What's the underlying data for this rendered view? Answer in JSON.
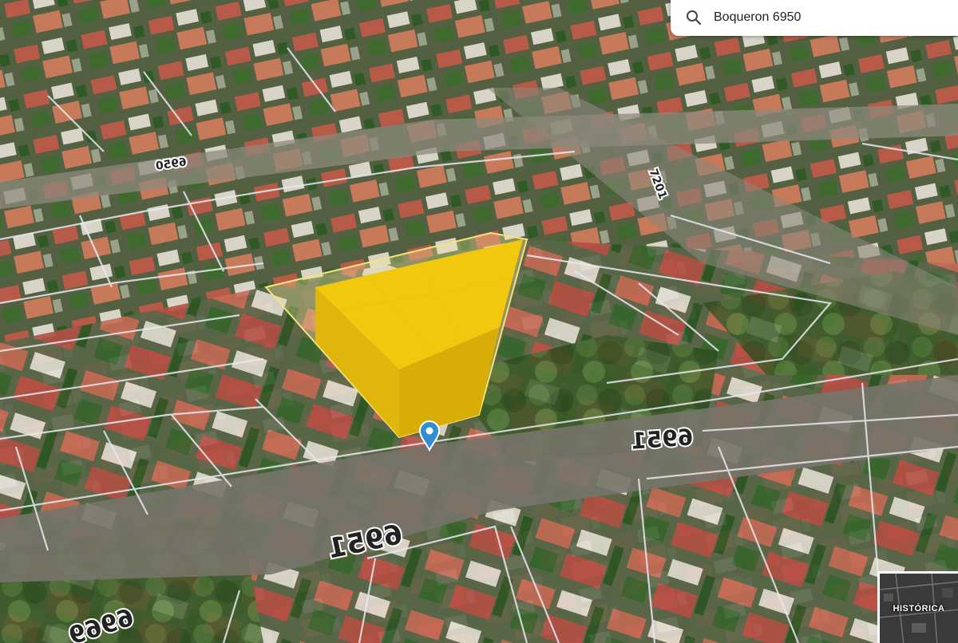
{
  "search": {
    "value": "Boqueron 6950",
    "icon": "search-icon"
  },
  "map": {
    "view": "3d-satellite",
    "highlight_color": "#f2c80f",
    "marker_color": "#2f8fd0",
    "marker_icon": "location-pin-icon",
    "street_labels": [
      "6951",
      "6951",
      "6969",
      "6950",
      "7201"
    ]
  },
  "historica_button": {
    "label": "HISTÓRICA"
  }
}
